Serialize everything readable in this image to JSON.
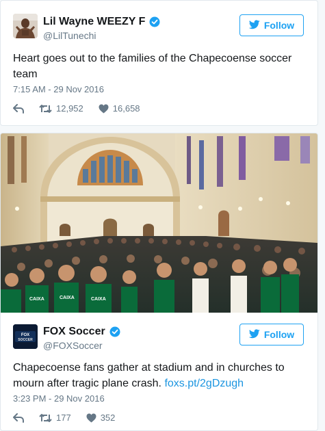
{
  "tweets": [
    {
      "display_name": "Lil Wayne WEEZY F",
      "handle": "@LilTunechi",
      "follow_label": "Follow",
      "text": "Heart goes out to the families of the Chapecoense soccer team",
      "timestamp": "7:15 AM - 29 Nov 2016",
      "retweets": "12,952",
      "likes": "16,658"
    },
    {
      "display_name": "FOX Soccer",
      "handle": "@FOXSoccer",
      "follow_label": "Follow",
      "text": "Chapecoense fans gather at stadium and in churches to mourn after tragic plane crash.",
      "link": "foxs.pt/2gDzugh",
      "timestamp": "3:23 PM - 29 Nov 2016",
      "retweets": "177",
      "likes": "352",
      "avatar_logo_text": "FOX SOCCER"
    }
  ],
  "colors": {
    "accent": "#1da1f2",
    "link": "#1b95e0",
    "muted": "#657786",
    "border": "#e1e8ed",
    "jersey_green": "#0a6b3a"
  },
  "icons": [
    "verified-badge-icon",
    "twitter-bird-icon",
    "reply-icon",
    "retweet-icon",
    "heart-icon"
  ]
}
